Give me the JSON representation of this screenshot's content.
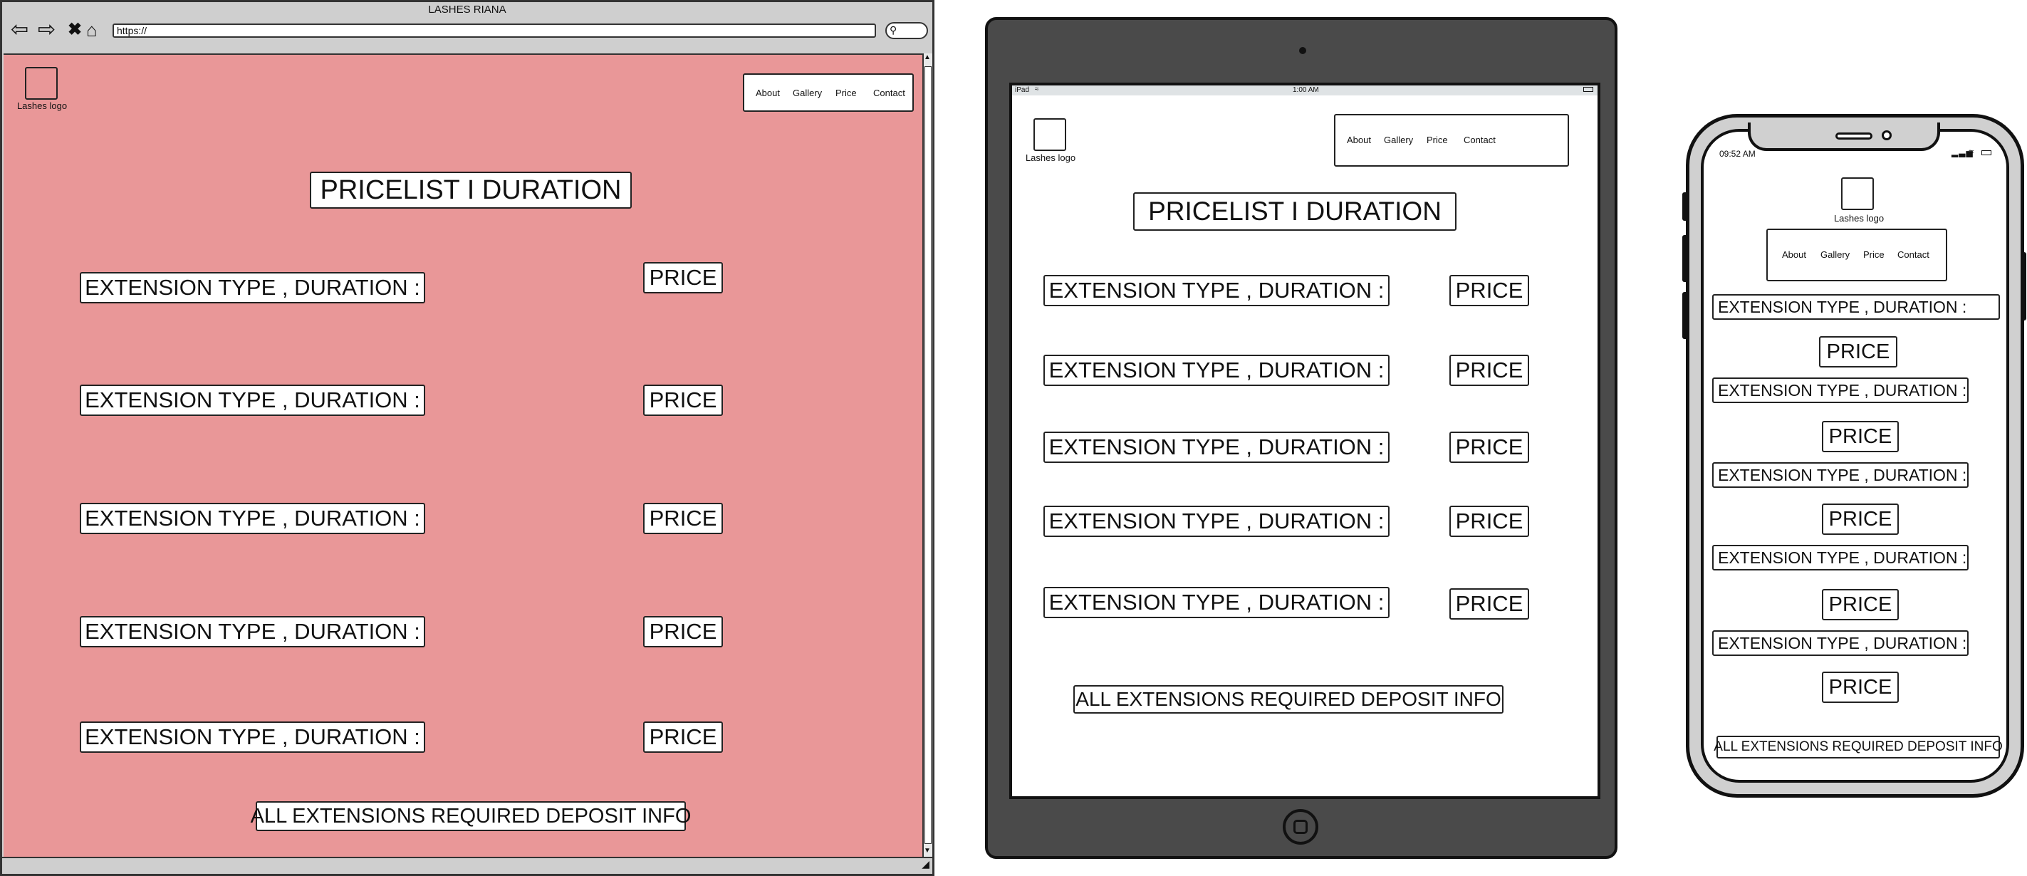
{
  "browser": {
    "window_title": "LASHES RIANA",
    "url": "https://",
    "logo_label": "Lashes logo",
    "nav": [
      "About",
      "Gallery",
      "Price",
      "Contact"
    ],
    "page_title": "PRICELIST I DURATION",
    "rows": [
      {
        "label": "EXTENSION TYPE , DURATION :",
        "price": "PRICE"
      },
      {
        "label": "EXTENSION TYPE , DURATION :",
        "price": "PRICE"
      },
      {
        "label": "EXTENSION TYPE , DURATION :",
        "price": "PRICE"
      },
      {
        "label": "EXTENSION TYPE , DURATION :",
        "price": "PRICE"
      },
      {
        "label": "EXTENSION TYPE , DURATION :",
        "price": "PRICE"
      }
    ],
    "deposit_info": "ALL EXTENSIONS REQUIRED DEPOSIT INFO",
    "content_bg": "#e99798"
  },
  "tablet": {
    "status_left": "iPad",
    "status_time": "1:00 AM",
    "logo_label": "Lashes logo",
    "nav": [
      "About",
      "Gallery",
      "Price",
      "Contact"
    ],
    "page_title": "PRICELIST I DURATION",
    "rows": [
      {
        "label": "EXTENSION TYPE , DURATION :",
        "price": "PRICE"
      },
      {
        "label": "EXTENSION TYPE , DURATION :",
        "price": "PRICE"
      },
      {
        "label": "EXTENSION TYPE , DURATION :",
        "price": "PRICE"
      },
      {
        "label": "EXTENSION TYPE , DURATION :",
        "price": "PRICE"
      },
      {
        "label": "EXTENSION TYPE , DURATION :",
        "price": "PRICE"
      }
    ],
    "deposit_info": "ALL EXTENSIONS REQUIRED DEPOSIT INFO"
  },
  "phone": {
    "status_time": "09:52 AM",
    "logo_label": "Lashes logo",
    "nav": [
      "About",
      "Gallery",
      "Price",
      "Contact"
    ],
    "rows": [
      {
        "label": "EXTENSION TYPE , DURATION :",
        "price": "PRICE"
      },
      {
        "label": "EXTENSION TYPE , DURATION :",
        "price": "PRICE"
      },
      {
        "label": "EXTENSION TYPE , DURATION :",
        "price": "PRICE"
      },
      {
        "label": "EXTENSION TYPE , DURATION :",
        "price": "PRICE"
      },
      {
        "label": "EXTENSION TYPE , DURATION :",
        "price": "PRICE"
      }
    ],
    "deposit_info": "ALL EXTENSIONS REQUIRED DEPOSIT INFO"
  },
  "icons": {
    "back": "back-arrow-icon",
    "forward": "forward-arrow-icon",
    "stop": "close-icon",
    "home": "home-icon",
    "search": "search-icon"
  }
}
